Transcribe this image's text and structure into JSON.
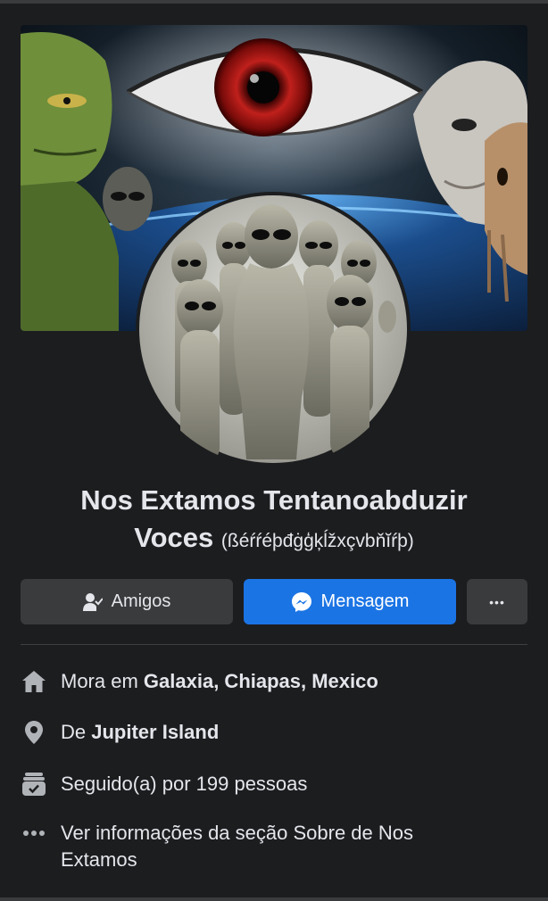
{
  "profile": {
    "name": "Nos Extamos Tentanoabduzir Voces",
    "name_line1": "Nos Extamos Tentanoabduzir",
    "name_line2": "Voces",
    "alternate_name": "(ßéŕŕéþđġģķĺžxçvbňĭŕþ)"
  },
  "actions": {
    "friends_label": "Amigos",
    "message_label": "Mensagem",
    "more_label": "•••"
  },
  "info": {
    "lives_prefix": "Mora em ",
    "lives_value": "Galaxia, Chiapas, Mexico",
    "from_prefix": "De ",
    "from_value": "Jupiter Island",
    "followers_text": "Seguido(a) por 199 pessoas",
    "about_text": "Ver informações da seção Sobre de Nos Extamos"
  },
  "icons": {
    "home": "home-icon",
    "location": "location-pin-icon",
    "followers": "followers-icon",
    "more": "more-dots-icon",
    "friends": "friends-icon",
    "messenger": "messenger-icon"
  },
  "colors": {
    "background": "#1c1d1f",
    "button_secondary": "#3a3b3c",
    "button_primary": "#1b74e4",
    "text": "#e4e6eb"
  }
}
